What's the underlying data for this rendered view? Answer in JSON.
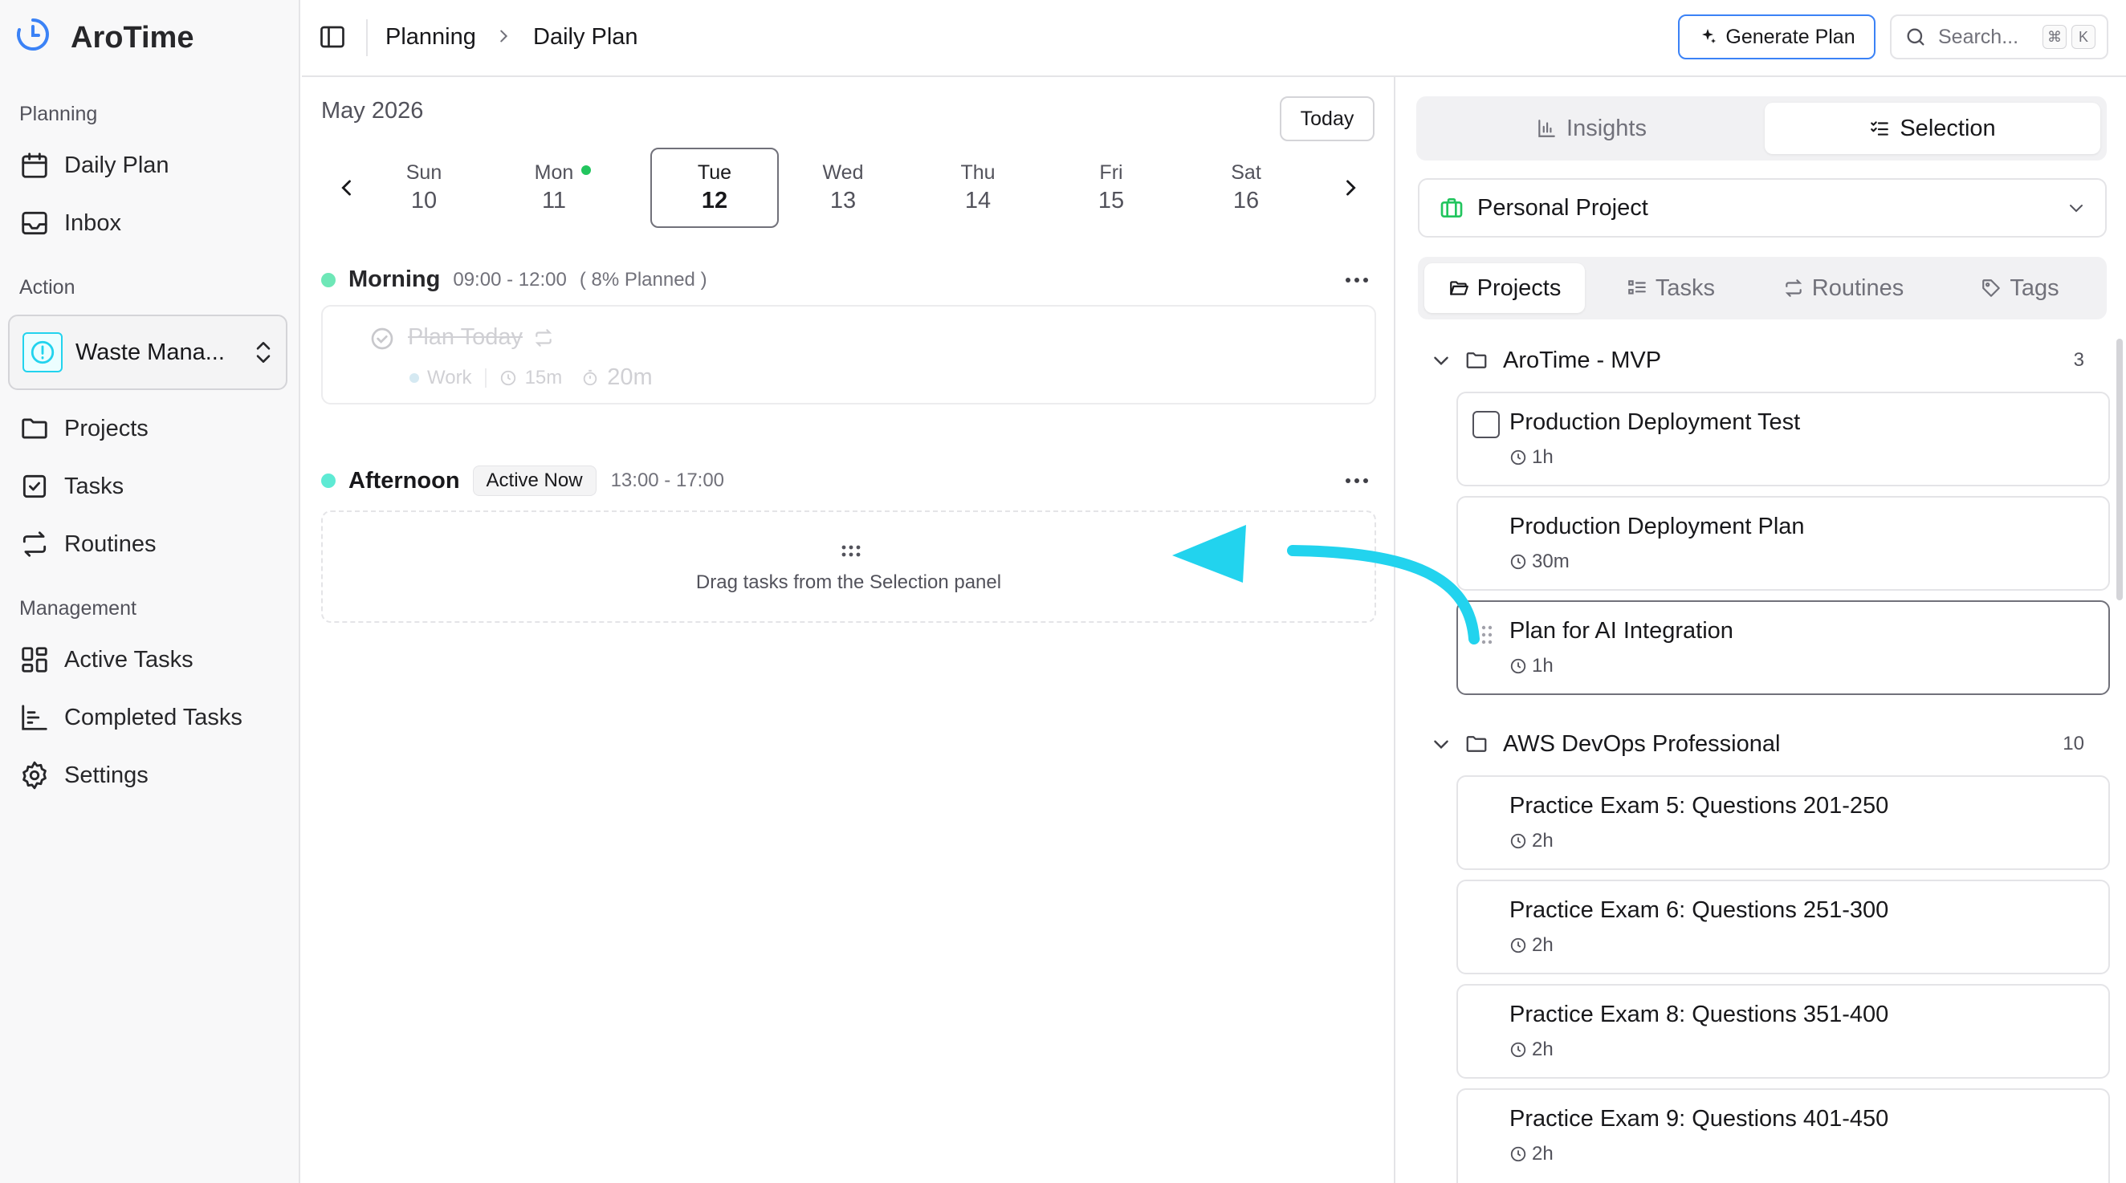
{
  "app": {
    "name": "AroTime"
  },
  "sidebar": {
    "groups": {
      "planning": "Planning",
      "action": "Action",
      "management": "Management"
    },
    "planning_items": [
      {
        "label": "Daily Plan",
        "icon": "calendar-icon"
      },
      {
        "label": "Inbox",
        "icon": "inbox-icon"
      }
    ],
    "action_select": {
      "label": "Waste Mana...",
      "icon": "alert-circle-icon"
    },
    "action_items": [
      {
        "label": "Projects",
        "icon": "folder-icon"
      },
      {
        "label": "Tasks",
        "icon": "checkbox-icon"
      },
      {
        "label": "Routines",
        "icon": "repeat-icon"
      }
    ],
    "management_items": [
      {
        "label": "Active Tasks",
        "icon": "dashboard-icon"
      },
      {
        "label": "Completed Tasks",
        "icon": "bar-chart-icon"
      },
      {
        "label": "Settings",
        "icon": "gear-icon"
      }
    ]
  },
  "header": {
    "breadcrumb": [
      "Planning",
      "Daily Plan"
    ],
    "generate_label": "Generate Plan",
    "search_placeholder": "Search...",
    "shortcut": [
      "⌘",
      "K"
    ]
  },
  "calendar": {
    "month": "May 2026",
    "today_label": "Today",
    "days": [
      {
        "name": "Sun",
        "date": "10",
        "selected": false,
        "dot": false
      },
      {
        "name": "Mon",
        "date": "11",
        "selected": false,
        "dot": true
      },
      {
        "name": "Tue",
        "date": "12",
        "selected": true,
        "dot": false
      },
      {
        "name": "Wed",
        "date": "13",
        "selected": false,
        "dot": false
      },
      {
        "name": "Thu",
        "date": "14",
        "selected": false,
        "dot": false
      },
      {
        "name": "Fri",
        "date": "15",
        "selected": false,
        "dot": false
      },
      {
        "name": "Sat",
        "date": "16",
        "selected": false,
        "dot": false
      }
    ]
  },
  "slots": {
    "morning": {
      "title": "Morning",
      "time": "09:00 - 12:00",
      "planned": "( 8% Planned )",
      "task": {
        "name": "Plan Today",
        "tag": "Work",
        "estimate": "15m",
        "actual": "20m"
      }
    },
    "afternoon": {
      "title": "Afternoon",
      "badge": "Active Now",
      "time": "13:00 - 17:00",
      "dropzone": "Drag tasks from the Selection panel"
    }
  },
  "right_panel": {
    "segments": [
      "Insights",
      "Selection"
    ],
    "active_segment": "Selection",
    "project_select": "Personal Project",
    "tabs": [
      "Projects",
      "Tasks",
      "Routines",
      "Tags"
    ],
    "active_tab": "Projects",
    "groups": [
      {
        "name": "AroTime - MVP",
        "count": "3",
        "tasks": [
          {
            "name": "Production Deployment Test",
            "duration": "1h"
          },
          {
            "name": "Production Deployment Plan",
            "duration": "30m"
          },
          {
            "name": "Plan for AI Integration",
            "duration": "1h"
          }
        ]
      },
      {
        "name": "AWS DevOps Professional",
        "count": "10",
        "tasks": [
          {
            "name": "Practice Exam 5: Questions 201-250",
            "duration": "2h"
          },
          {
            "name": "Practice Exam 6: Questions 251-300",
            "duration": "2h"
          },
          {
            "name": "Practice Exam 8: Questions 351-400",
            "duration": "2h"
          },
          {
            "name": "Practice Exam 9: Questions 401-450",
            "duration": "2h"
          }
        ]
      }
    ]
  },
  "colors": {
    "accent_blue": "#3b82f6",
    "arrow_cyan": "#22d3ee",
    "morning_dot": "#6ee7b7",
    "afternoon_dot": "#5eead4",
    "mon_dot": "#22c55e",
    "project_icon": "#22c55e"
  }
}
